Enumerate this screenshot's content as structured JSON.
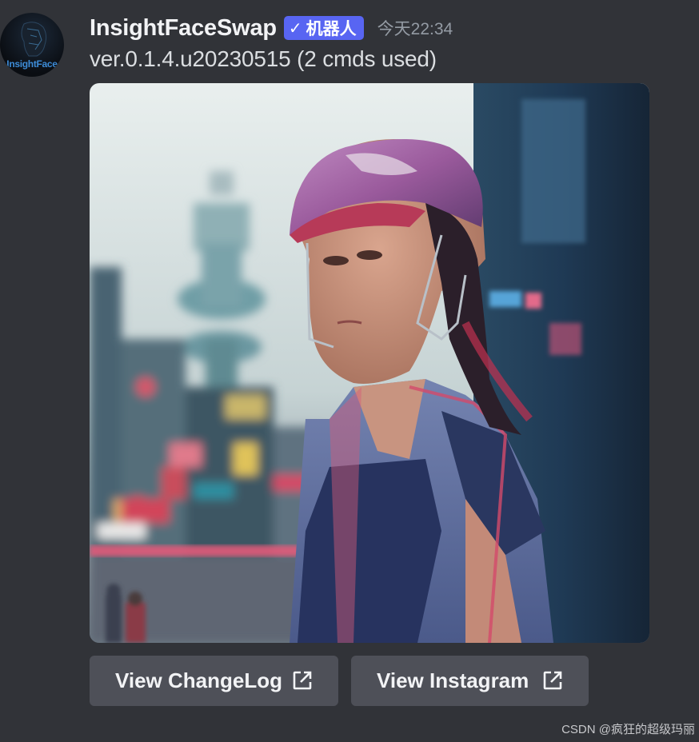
{
  "message": {
    "author": "InsightFaceSwap",
    "avatar_text": "InsightFace",
    "bot_badge": {
      "icon": "check-icon",
      "label": "机器人"
    },
    "timestamp": "今天22:34",
    "content": "ver.0.1.4.u20230515 (2 cmds used)",
    "attachment": {
      "type": "image",
      "description_icon": "ai-generated-portrait-image"
    }
  },
  "buttons": [
    {
      "label": "View ChangeLog",
      "icon": "external-link-icon"
    },
    {
      "label": "View Instagram",
      "icon": "external-link-icon"
    }
  ],
  "watermark": "CSDN @疯狂的超级玛丽",
  "colors": {
    "background": "#313338",
    "bot_badge": "#5865f2",
    "button": "#4e5058",
    "timestamp": "#949ba4"
  }
}
